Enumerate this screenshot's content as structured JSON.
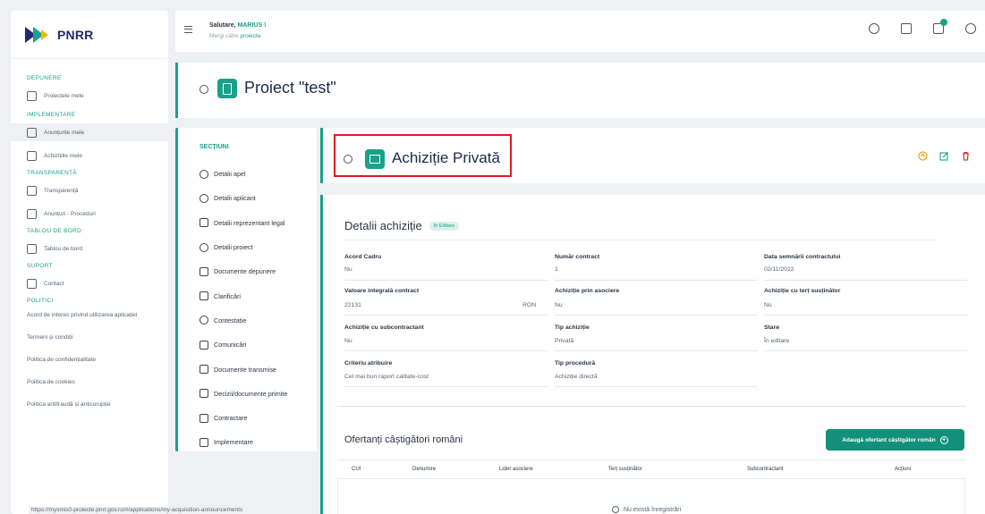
{
  "brand": {
    "logo_text": "PNRR"
  },
  "sidebar": {
    "depunere": {
      "title": "DEPUNERE",
      "items": [
        {
          "label": "Proiectele mele"
        }
      ]
    },
    "implementare": {
      "title": "IMPLEMENTARE",
      "items": [
        {
          "label": "Anunțurile mele"
        },
        {
          "label": "Achizițiile mele"
        }
      ]
    },
    "transparenta": {
      "title": "TRANSPARENȚĂ",
      "items": [
        {
          "label": "Transparență"
        },
        {
          "label": "Anunțuri - Proceduri"
        }
      ]
    },
    "tablou": {
      "title": "TABLOU DE BORD",
      "items": [
        {
          "label": "Tablou de bord"
        }
      ]
    },
    "suport": {
      "title": "SUPORT",
      "items": [
        {
          "label": "Contact"
        }
      ]
    },
    "politici": {
      "title": "POLITICI",
      "items": [
        {
          "label": "Acord de interes privind utilizarea aplicației"
        },
        {
          "label": "Termeni și condiții"
        },
        {
          "label": "Politica de confidențialitate"
        },
        {
          "label": "Politica de cookies"
        },
        {
          "label": "Politica antifraudă și anticorupție"
        }
      ]
    }
  },
  "topbar": {
    "greeting": "Salutare, ",
    "user": "MARIUS !",
    "goto_prefix": "Mergi către ",
    "goto_link": "proiecte"
  },
  "project": {
    "title": "Proiect \"test\""
  },
  "sections": {
    "title": "SECȚIUNI",
    "items": [
      {
        "label": "Detalii apel"
      },
      {
        "label": "Detalii aplicant"
      },
      {
        "label": "Detalii reprezentant legal"
      },
      {
        "label": "Detalii proiect"
      },
      {
        "label": "Documente depunere"
      },
      {
        "label": "Clarificări"
      },
      {
        "label": "Contestație"
      },
      {
        "label": "Comunicări"
      },
      {
        "label": "Documente transmise"
      },
      {
        "label": "Decizii/documente primite"
      },
      {
        "label": "Contractare"
      },
      {
        "label": "Implementare"
      }
    ]
  },
  "acquisition": {
    "title": "Achiziție Privată"
  },
  "details": {
    "title": "Detalii achiziție",
    "status_pill": "În Editare",
    "fields": [
      {
        "label": "Acord Cadru",
        "value": "Nu"
      },
      {
        "label": "Număr contract",
        "value": "1"
      },
      {
        "label": "Data semnării contractului",
        "value": "02/11/2022"
      },
      {
        "label": "Valoare integrală contract",
        "value": "22131",
        "unit": "RON"
      },
      {
        "label": "Achiziție prin asociere",
        "value": "Nu"
      },
      {
        "label": "Achiziție cu terț susținător",
        "value": "Nu"
      },
      {
        "label": "Achiziție cu subcontractant",
        "value": "Nu"
      },
      {
        "label": "Tip achiziție",
        "value": "Privată"
      },
      {
        "label": "Stare",
        "value": "În editare"
      },
      {
        "label": "Criteriu atribuire",
        "value": "Cel mai bun raport calitate-cost"
      },
      {
        "label": "Tip procedură",
        "value": "Achiziție directă"
      }
    ]
  },
  "offers": {
    "title": "Ofertanți câștigători români",
    "add_button": "Adaugă ofertant câștigător român",
    "columns": [
      "CUI",
      "Denumire",
      "Lider asociere",
      "Terț susținător",
      "Subcontractant",
      "Acțiuni"
    ],
    "empty": "Nu există înregistrări"
  },
  "status_url": "https://mysmis0-proiecte.pnrr.gov.ro/#/applications/my-acquisition-announcements",
  "colors": {
    "accent": "#1aa189",
    "button": "#13907a",
    "highlight_box": "#e0191f",
    "brand_navy": "#1c2b6f"
  }
}
